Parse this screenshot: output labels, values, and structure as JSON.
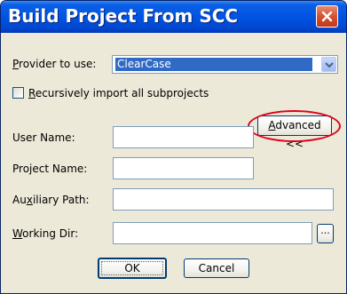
{
  "window": {
    "title": "Build Project From SCC",
    "close_icon": "close-icon"
  },
  "provider": {
    "label": "Provider to use:",
    "label_access_key": "P",
    "label_rest": "rovider to use:",
    "selected": "ClearCase",
    "arrow_icon": "chevron-down-icon"
  },
  "recursive": {
    "label": "Recursively import all subprojects",
    "label_access_key": "R",
    "label_rest": "ecursively import all subprojects",
    "checked": false
  },
  "advanced_button": {
    "label": "Advanced <<",
    "label_access_key": "A",
    "label_rest": "dvanced <<",
    "highlight_color": "#e0001a"
  },
  "fields": {
    "user_name": {
      "label": "User Name:",
      "value": ""
    },
    "project_name": {
      "label": "Project Name:",
      "value": ""
    },
    "auxiliary_path": {
      "label": "Auxiliary Path:",
      "label_pre": "Au",
      "label_access_key": "x",
      "label_rest": "iliary Path:",
      "value": ""
    },
    "working_dir": {
      "label": "Working Dir:",
      "label_access_key": "W",
      "label_rest": "orking Dir:",
      "value": ""
    }
  },
  "browse_button": {
    "label": "..."
  },
  "buttons": {
    "ok": "OK",
    "cancel": "Cancel"
  },
  "colors": {
    "titlebar": "#0054e3",
    "dialog_bg": "#ece9d8",
    "selection": "#316ac5",
    "close_button": "#d65231"
  }
}
